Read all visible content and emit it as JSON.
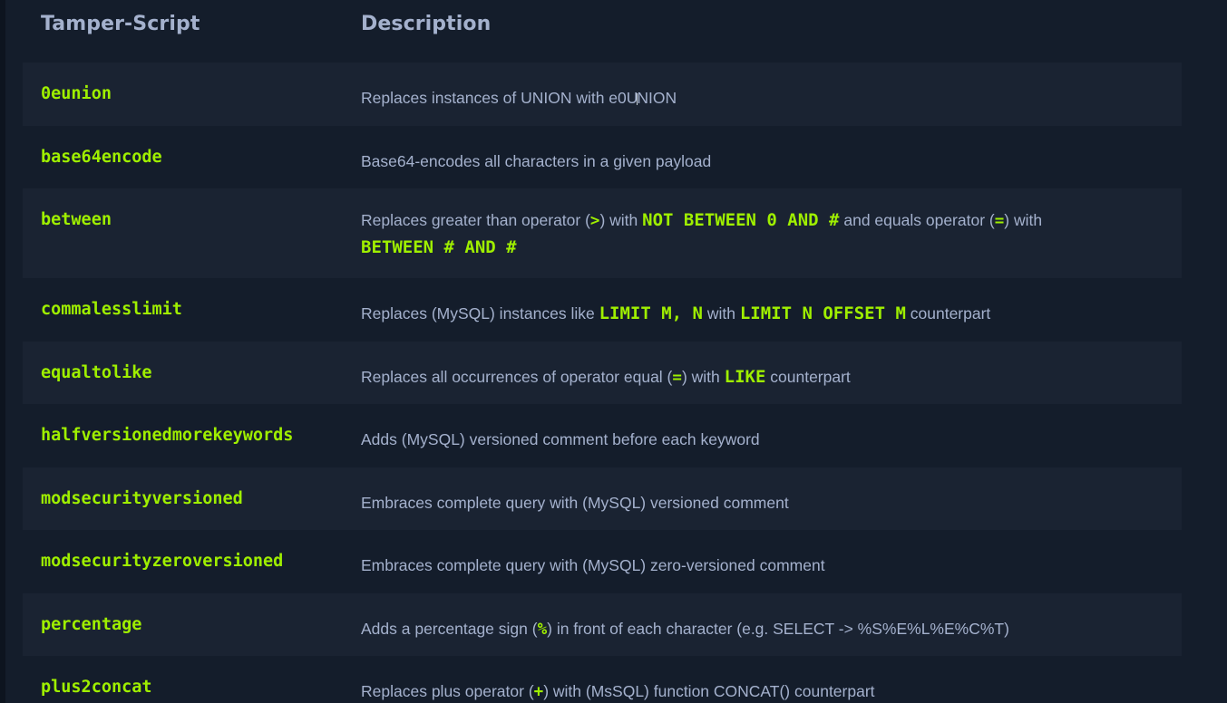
{
  "header": {
    "col1": "Tamper-Script",
    "col2": "Description"
  },
  "rows": [
    {
      "script": "0eunion",
      "desc": [
        "Replaces instances of UNION with e0U",
        "NION"
      ]
    },
    {
      "script": "base64encode",
      "desc": [
        "Base64-encodes all characters in a given payload"
      ]
    },
    {
      "script": "between",
      "desc": [
        "Replaces greater than operator (",
        ">",
        ") with ",
        "NOT BETWEEN 0 AND #",
        " and equals operator (",
        "=",
        ") with",
        "BETWEEN # AND #"
      ]
    },
    {
      "script": "commalesslimit",
      "desc": [
        "Replaces (MySQL) instances like ",
        "LIMIT M, N",
        " with ",
        "LIMIT N OFFSET M",
        " counterpart"
      ]
    },
    {
      "script": "equaltolike",
      "desc": [
        "Replaces all occurrences of operator equal (",
        "=",
        ") with ",
        "LIKE",
        " counterpart"
      ]
    },
    {
      "script": "halfversionedmorekeywords",
      "desc": [
        "Adds (MySQL) versioned comment before each keyword"
      ]
    },
    {
      "script": "modsecurityversioned",
      "desc": [
        "Embraces complete query with (MySQL) versioned comment"
      ]
    },
    {
      "script": "modsecurityzeroversioned",
      "desc": [
        "Embraces complete query with (MySQL) zero-versioned comment"
      ]
    },
    {
      "script": "percentage",
      "desc": [
        "Adds a percentage sign (",
        "%",
        ") in front of each character (e.g. SELECT -> %S%E%L%E%C%T)"
      ]
    },
    {
      "script": "plus2concat",
      "desc": [
        "Replaces plus operator (",
        "+",
        ") with (MsSQL) function CONCAT() counterpart"
      ]
    }
  ],
  "colors": {
    "background": "#141d2b",
    "stripe": "#1a2332",
    "accent_green": "#9fef00",
    "text": "#a4b1cd"
  }
}
